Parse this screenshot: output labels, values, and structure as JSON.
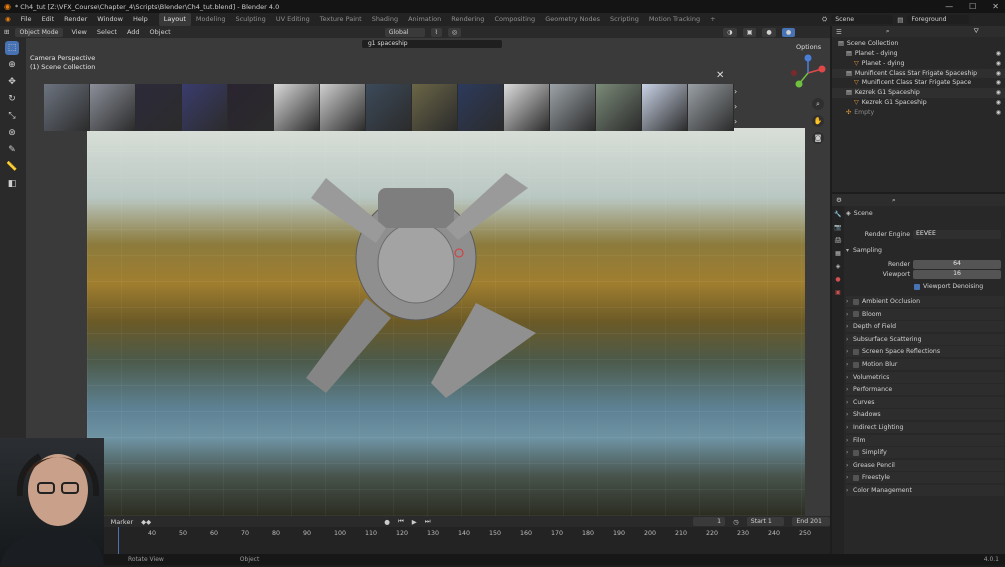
{
  "window": {
    "title": "* Ch4_tut [Z:\\VFX_Course\\Chapter_4\\Scripts\\Blender\\Ch4_tut.blend] - Blender 4.0",
    "controls": [
      "—",
      "☐",
      "✕"
    ]
  },
  "menu": {
    "items": [
      "File",
      "Edit",
      "Render",
      "Window",
      "Help"
    ],
    "workspaces": [
      "Layout",
      "Modeling",
      "Sculpting",
      "UV Editing",
      "Texture Paint",
      "Shading",
      "Animation",
      "Rendering",
      "Compositing",
      "Geometry Nodes",
      "Scripting",
      "Motion Tracking"
    ],
    "active_workspace": "Layout",
    "add_tab": "+",
    "scene_label": "Scene",
    "viewlayer_label": "Foreground"
  },
  "viewport_header": {
    "mode": "Object Mode",
    "menus": [
      "View",
      "Select",
      "Add",
      "Object"
    ],
    "transform_orientation": "Global",
    "search_value": "g1 spaceship",
    "options_label": "Options"
  },
  "viewport": {
    "camera_line1": "Camera Perspective",
    "camera_line2": "(1) Scene Collection",
    "gizmo_axes": [
      "X",
      "Y",
      "Z"
    ],
    "close_icon": "✕",
    "nav_buttons": [
      "zoom-icon",
      "hand-icon",
      "camera-icon",
      "grid-icon"
    ]
  },
  "asset_browser": {
    "thumbnail_count": 15,
    "thumbnail_colors": [
      "#6d7480",
      "#8b8f99",
      "#2d2a3a",
      "#3a3c6d",
      "#2a2430",
      "#d9d9d9",
      "#cfcfcf",
      "#3c4a5a",
      "#6b6647",
      "#2c3a5c",
      "#dcdcdc",
      "#9ca3a8",
      "#7a8a78",
      "#c9d3e6",
      "#9aa0a5"
    ]
  },
  "timeline": {
    "marker_label": "Marker",
    "current_frame": "1",
    "start_label": "Start",
    "start_value": "1",
    "end_label": "End",
    "end_value": "201",
    "ticks": [
      "40",
      "50",
      "60",
      "70",
      "80",
      "90",
      "100",
      "110",
      "120",
      "130",
      "140",
      "150",
      "160",
      "170",
      "180",
      "190",
      "200",
      "210",
      "220",
      "230",
      "240",
      "250"
    ]
  },
  "status": {
    "left": "Rotate View",
    "mid": "Object",
    "version": "4.0.1"
  },
  "outliner": {
    "header": "Scene Collection",
    "rows": [
      {
        "label": "Planet - dying",
        "indent": 1,
        "type": "collection"
      },
      {
        "label": "Planet - dying",
        "indent": 2,
        "type": "object"
      },
      {
        "label": "Munificent Class Star Frigate Spaceship",
        "indent": 1,
        "type": "collection"
      },
      {
        "label": "Munificent Class Star Frigate Space",
        "indent": 2,
        "type": "object"
      },
      {
        "label": "Kezrek G1 Spaceship",
        "indent": 1,
        "type": "collection"
      },
      {
        "label": "Kezrek G1 Spaceship",
        "indent": 2,
        "type": "object"
      },
      {
        "label": "Empty",
        "indent": 1,
        "type": "empty"
      }
    ]
  },
  "properties": {
    "scene_label": "Scene",
    "render_engine_label": "Render Engine",
    "render_engine_value": "EEVEE",
    "sampling_label": "Sampling",
    "render_samples_label": "Render",
    "render_samples_value": "64",
    "viewport_samples_label": "Viewport",
    "viewport_samples_value": "16",
    "denoise_label": "Viewport Denoising",
    "panels": [
      {
        "label": "Ambient Occlusion",
        "checkbox": true
      },
      {
        "label": "Bloom",
        "checkbox": true
      },
      {
        "label": "Depth of Field",
        "checkbox": false
      },
      {
        "label": "Subsurface Scattering",
        "checkbox": false
      },
      {
        "label": "Screen Space Reflections",
        "checkbox": true
      },
      {
        "label": "Motion Blur",
        "checkbox": true
      },
      {
        "label": "Volumetrics",
        "checkbox": false
      },
      {
        "label": "Performance",
        "checkbox": false
      },
      {
        "label": "Curves",
        "checkbox": false
      },
      {
        "label": "Shadows",
        "checkbox": false
      },
      {
        "label": "Indirect Lighting",
        "checkbox": false
      },
      {
        "label": "Film",
        "checkbox": false
      },
      {
        "label": "Simplify",
        "checkbox": true
      },
      {
        "label": "Grease Pencil",
        "checkbox": false
      },
      {
        "label": "Freestyle",
        "checkbox": true
      },
      {
        "label": "Color Management",
        "checkbox": false
      }
    ]
  },
  "colors": {
    "accent": "#4772b3",
    "header": "#2a2a2a",
    "panel": "#282828"
  }
}
